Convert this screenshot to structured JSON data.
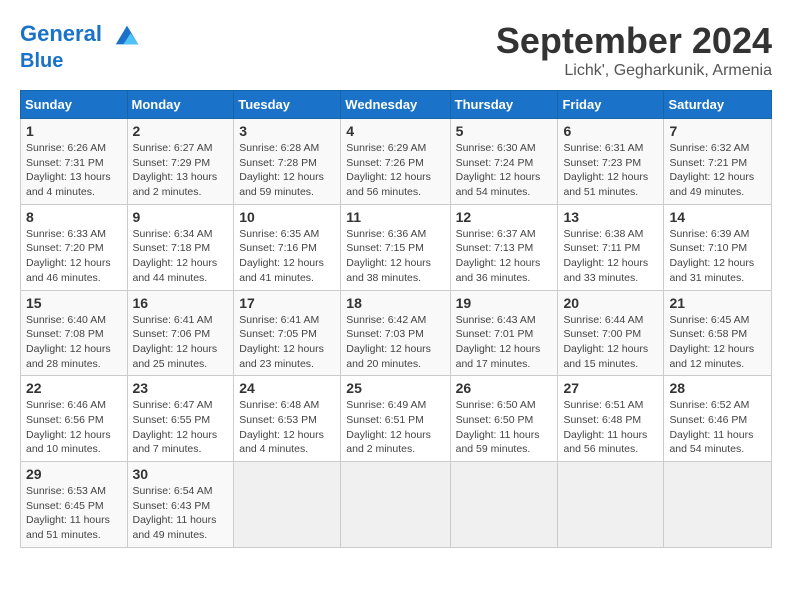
{
  "logo": {
    "line1": "General",
    "line2": "Blue"
  },
  "title": "September 2024",
  "location": "Lichk', Gegharkunik, Armenia",
  "headers": [
    "Sunday",
    "Monday",
    "Tuesday",
    "Wednesday",
    "Thursday",
    "Friday",
    "Saturday"
  ],
  "weeks": [
    [
      {
        "day": "1",
        "info": "Sunrise: 6:26 AM\nSunset: 7:31 PM\nDaylight: 13 hours and 4 minutes."
      },
      {
        "day": "2",
        "info": "Sunrise: 6:27 AM\nSunset: 7:29 PM\nDaylight: 13 hours and 2 minutes."
      },
      {
        "day": "3",
        "info": "Sunrise: 6:28 AM\nSunset: 7:28 PM\nDaylight: 12 hours and 59 minutes."
      },
      {
        "day": "4",
        "info": "Sunrise: 6:29 AM\nSunset: 7:26 PM\nDaylight: 12 hours and 56 minutes."
      },
      {
        "day": "5",
        "info": "Sunrise: 6:30 AM\nSunset: 7:24 PM\nDaylight: 12 hours and 54 minutes."
      },
      {
        "day": "6",
        "info": "Sunrise: 6:31 AM\nSunset: 7:23 PM\nDaylight: 12 hours and 51 minutes."
      },
      {
        "day": "7",
        "info": "Sunrise: 6:32 AM\nSunset: 7:21 PM\nDaylight: 12 hours and 49 minutes."
      }
    ],
    [
      {
        "day": "8",
        "info": "Sunrise: 6:33 AM\nSunset: 7:20 PM\nDaylight: 12 hours and 46 minutes."
      },
      {
        "day": "9",
        "info": "Sunrise: 6:34 AM\nSunset: 7:18 PM\nDaylight: 12 hours and 44 minutes."
      },
      {
        "day": "10",
        "info": "Sunrise: 6:35 AM\nSunset: 7:16 PM\nDaylight: 12 hours and 41 minutes."
      },
      {
        "day": "11",
        "info": "Sunrise: 6:36 AM\nSunset: 7:15 PM\nDaylight: 12 hours and 38 minutes."
      },
      {
        "day": "12",
        "info": "Sunrise: 6:37 AM\nSunset: 7:13 PM\nDaylight: 12 hours and 36 minutes."
      },
      {
        "day": "13",
        "info": "Sunrise: 6:38 AM\nSunset: 7:11 PM\nDaylight: 12 hours and 33 minutes."
      },
      {
        "day": "14",
        "info": "Sunrise: 6:39 AM\nSunset: 7:10 PM\nDaylight: 12 hours and 31 minutes."
      }
    ],
    [
      {
        "day": "15",
        "info": "Sunrise: 6:40 AM\nSunset: 7:08 PM\nDaylight: 12 hours and 28 minutes."
      },
      {
        "day": "16",
        "info": "Sunrise: 6:41 AM\nSunset: 7:06 PM\nDaylight: 12 hours and 25 minutes."
      },
      {
        "day": "17",
        "info": "Sunrise: 6:41 AM\nSunset: 7:05 PM\nDaylight: 12 hours and 23 minutes."
      },
      {
        "day": "18",
        "info": "Sunrise: 6:42 AM\nSunset: 7:03 PM\nDaylight: 12 hours and 20 minutes."
      },
      {
        "day": "19",
        "info": "Sunrise: 6:43 AM\nSunset: 7:01 PM\nDaylight: 12 hours and 17 minutes."
      },
      {
        "day": "20",
        "info": "Sunrise: 6:44 AM\nSunset: 7:00 PM\nDaylight: 12 hours and 15 minutes."
      },
      {
        "day": "21",
        "info": "Sunrise: 6:45 AM\nSunset: 6:58 PM\nDaylight: 12 hours and 12 minutes."
      }
    ],
    [
      {
        "day": "22",
        "info": "Sunrise: 6:46 AM\nSunset: 6:56 PM\nDaylight: 12 hours and 10 minutes."
      },
      {
        "day": "23",
        "info": "Sunrise: 6:47 AM\nSunset: 6:55 PM\nDaylight: 12 hours and 7 minutes."
      },
      {
        "day": "24",
        "info": "Sunrise: 6:48 AM\nSunset: 6:53 PM\nDaylight: 12 hours and 4 minutes."
      },
      {
        "day": "25",
        "info": "Sunrise: 6:49 AM\nSunset: 6:51 PM\nDaylight: 12 hours and 2 minutes."
      },
      {
        "day": "26",
        "info": "Sunrise: 6:50 AM\nSunset: 6:50 PM\nDaylight: 11 hours and 59 minutes."
      },
      {
        "day": "27",
        "info": "Sunrise: 6:51 AM\nSunset: 6:48 PM\nDaylight: 11 hours and 56 minutes."
      },
      {
        "day": "28",
        "info": "Sunrise: 6:52 AM\nSunset: 6:46 PM\nDaylight: 11 hours and 54 minutes."
      }
    ],
    [
      {
        "day": "29",
        "info": "Sunrise: 6:53 AM\nSunset: 6:45 PM\nDaylight: 11 hours and 51 minutes."
      },
      {
        "day": "30",
        "info": "Sunrise: 6:54 AM\nSunset: 6:43 PM\nDaylight: 11 hours and 49 minutes."
      },
      null,
      null,
      null,
      null,
      null
    ]
  ]
}
